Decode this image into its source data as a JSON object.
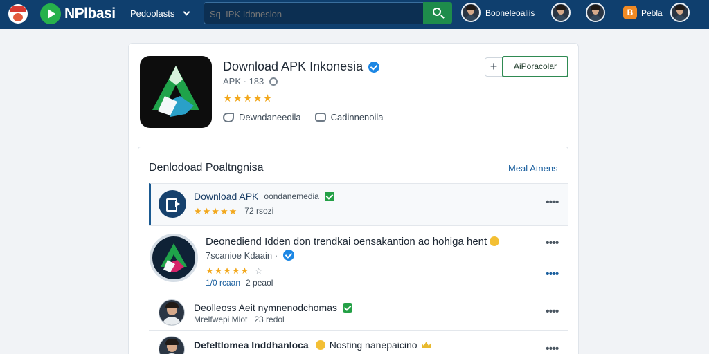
{
  "header": {
    "brand": "NPlbasi",
    "nav_dropdown": "Pedoolasts",
    "search": {
      "placeholder": "Sq  IPK Idoneslon"
    },
    "user_name": "Booneleoaliis",
    "badge_icon": "B",
    "user_name_2": "Pebla",
    "colors": {
      "bar": "#0f3f6e",
      "accent": "#1e8c4b"
    }
  },
  "app": {
    "title": "Download APK Inkonesia",
    "subtitle": "APK · 183",
    "rating_stars": "★★★★★",
    "rating_value": 4.5,
    "action_share": "Dewndaneeoila",
    "action_chat": "Cadinnenoila",
    "plus_label": "+",
    "follow_label": "AiPoracolar"
  },
  "panel": {
    "title": "Denlodoad Poaltngnisa",
    "link": "Meal Atnens",
    "items": [
      {
        "title": "Download APK",
        "sub": "oondanemedia",
        "stars": "★★★★★",
        "meta": "72 rsozi",
        "more": "••••"
      },
      {
        "title": "Deonediend Idden don trendkai oensakantion ao hohiga hent",
        "sub": "7scanioe Kdaain ·",
        "stars": "★★★★★",
        "stars_tiny": "☆",
        "meta_a": "1/0 rcaan",
        "meta_b": "2 peaol",
        "more": "••••"
      },
      {
        "title": "Deolleoss Aeit nymnenodchomas",
        "meta_a": "Mrelfwepi Mlot",
        "meta_b": "23 redol",
        "more": "••••"
      },
      {
        "title": "Defeltlomea Inddhanloca",
        "extra": "Nosting nanepaicino",
        "more": "••••"
      }
    ]
  }
}
